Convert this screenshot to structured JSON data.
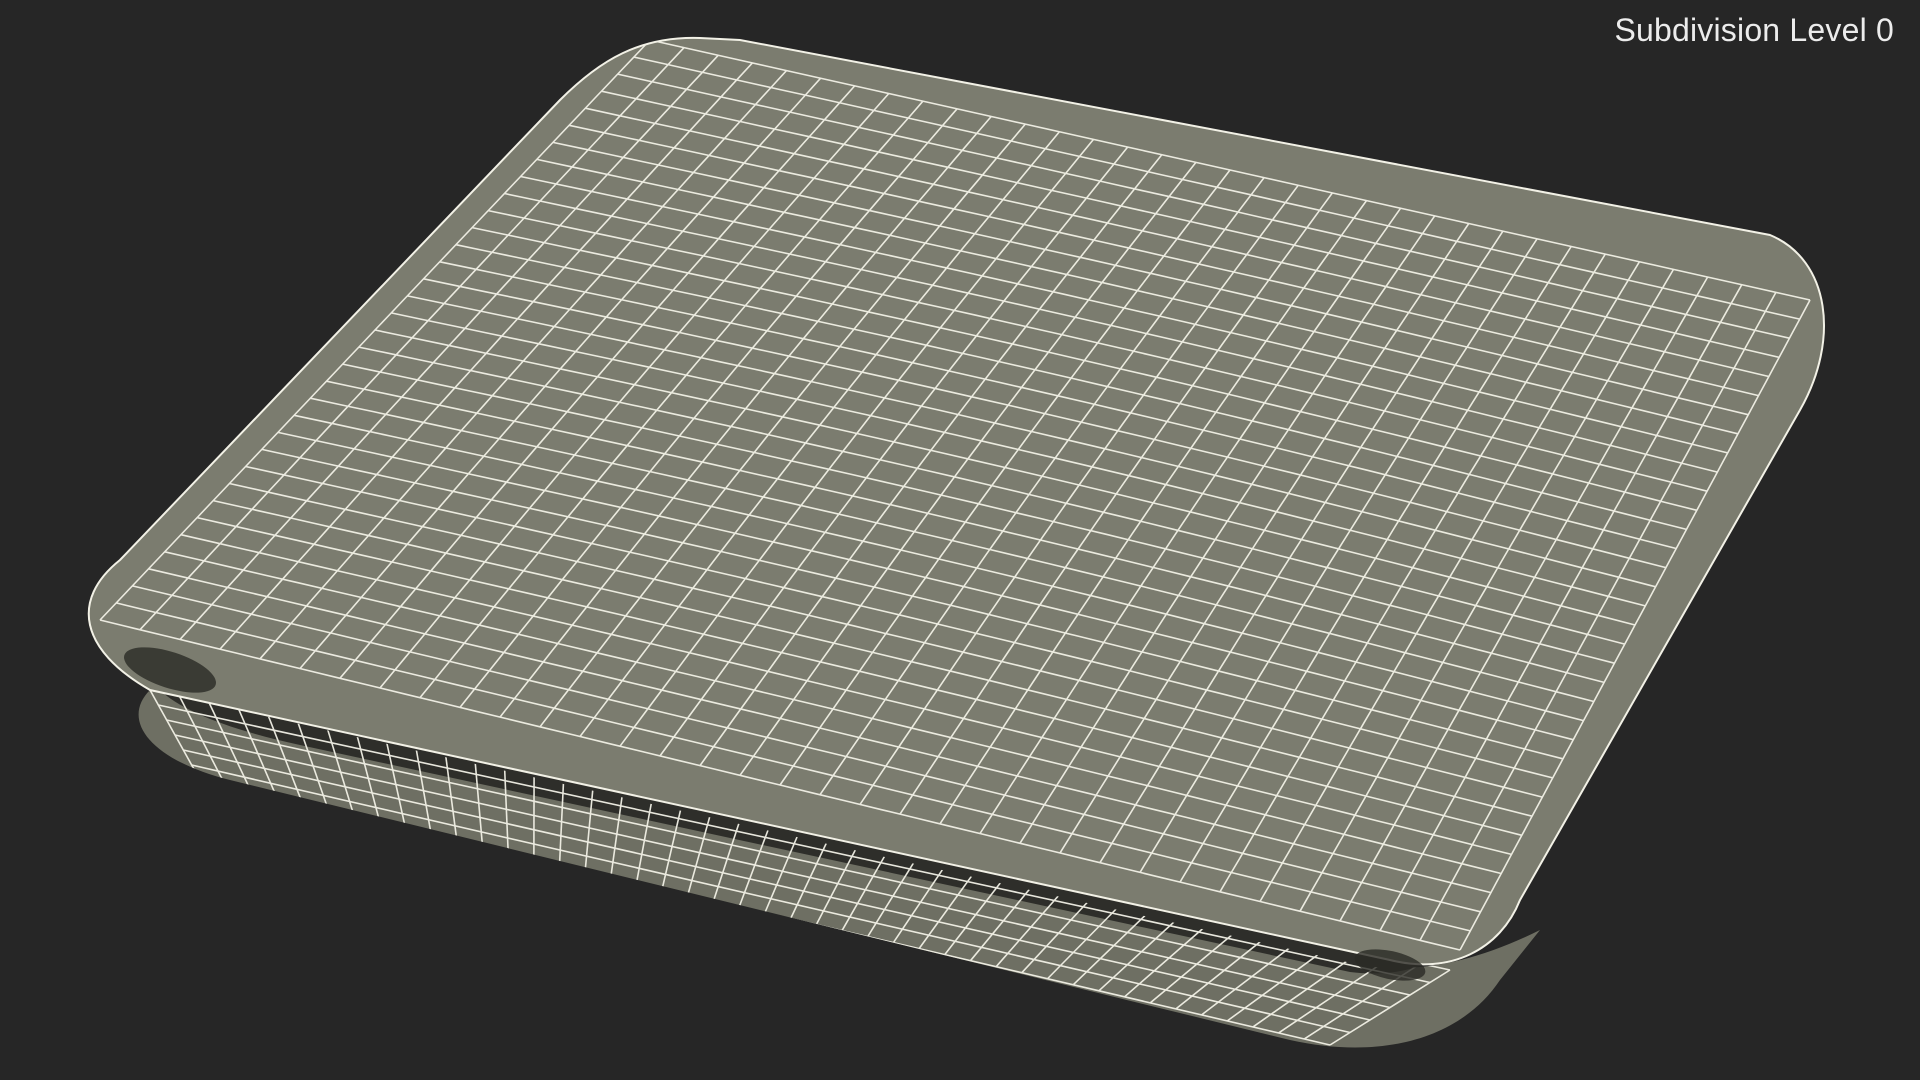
{
  "viewport": {
    "subdivision_label": "Subdivision Level 0"
  },
  "colors": {
    "background": "#262626",
    "surface": "#7b7c6f",
    "surface_shadow": "#3a3a34",
    "wire": "#f2f1e6",
    "label": "#ececec"
  },
  "model": {
    "name": "pillow-wireframe-mesh",
    "display": "wireframe-on-shaded"
  }
}
